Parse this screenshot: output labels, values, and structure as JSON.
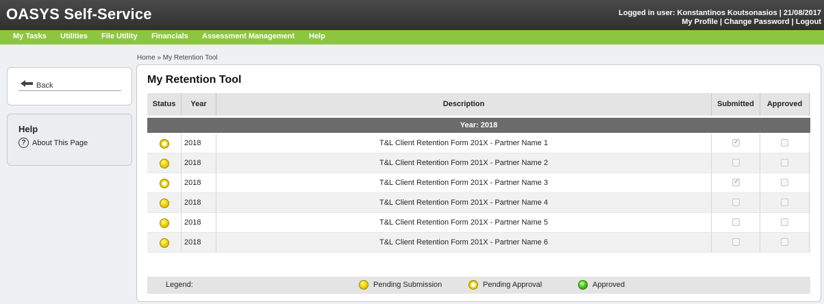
{
  "header": {
    "app_title": "OASYS Self-Service",
    "logged_in_text": "Logged in user: Konstantinos Koutsonasios  | 21/08/2017",
    "my_profile": "My Profile",
    "change_password": "Change Password",
    "logout": "Logout",
    "sep": " | "
  },
  "nav": {
    "items": [
      {
        "label": "My Tasks"
      },
      {
        "label": "Utilities"
      },
      {
        "label": "File Utility"
      },
      {
        "label": "Financials"
      },
      {
        "label": "Assessment Management"
      },
      {
        "label": "Help"
      }
    ]
  },
  "breadcrumb": "Home » My Retention Tool",
  "sidebar": {
    "back_label": "Back",
    "help_title": "Help",
    "about_label": "About This Page",
    "about_icon": "question-circle-icon"
  },
  "main": {
    "title": "My Retention Tool",
    "columns": {
      "status": "Status",
      "year": "Year",
      "description": "Description",
      "submitted": "Submitted",
      "approved": "Approved"
    },
    "group_label": "Year: 2018",
    "rows": [
      {
        "status": "pending-approval",
        "year": "2018",
        "description": "T&L Client Retention Form 201X - Partner Name 1",
        "submitted": true,
        "approved": false
      },
      {
        "status": "pending-submission",
        "year": "2018",
        "description": "T&L Client Retention Form 201X - Partner Name 2",
        "submitted": false,
        "approved": false
      },
      {
        "status": "pending-approval",
        "year": "2018",
        "description": "T&L Client Retention Form 201X - Partner Name 3",
        "submitted": true,
        "approved": false
      },
      {
        "status": "pending-submission",
        "year": "2018",
        "description": "T&L Client Retention Form 201X - Partner Name 4",
        "submitted": false,
        "approved": false
      },
      {
        "status": "pending-submission",
        "year": "2018",
        "description": "T&L Client Retention Form 201X - Partner Name 5",
        "submitted": false,
        "approved": false
      },
      {
        "status": "pending-submission",
        "year": "2018",
        "description": "T&L Client Retention Form 201X - Partner Name 6",
        "submitted": false,
        "approved": false
      }
    ]
  },
  "legend": {
    "label": "Legend:",
    "pending_submission": "Pending Submission",
    "pending_approval": "Pending Approval",
    "approved": "Approved"
  },
  "colors": {
    "nav_green": "#8cc63f",
    "header_dark": "#3a3a3a",
    "group_row": "#6b6b6b"
  }
}
